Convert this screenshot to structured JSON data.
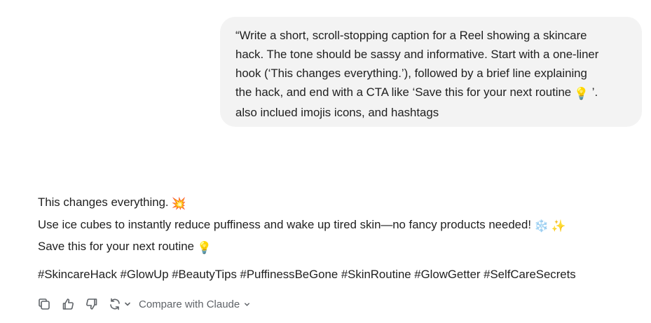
{
  "prompt": {
    "lines": [
      "“Write a short, scroll-stopping caption for a Reel showing a skincare",
      "hack. The tone should be sassy and informative. Start with a one-liner",
      "hook (‘This changes everything.’), followed by a brief line explaining",
      "the hack, and end with a CTA like ‘Save this for your next routine",
      "also inclued imojis icons, and hashtags"
    ],
    "line4_emoji": "💡",
    "line4_tail": " ’."
  },
  "response": {
    "hook": "This changes everything.",
    "hook_emoji": "💥",
    "explain": "Use ice cubes to instantly reduce puffiness and wake up tired skin—no fancy products needed!",
    "explain_emoji_1": "❄️",
    "explain_emoji_2": "✨",
    "cta": "Save this for your next routine",
    "cta_emoji": "💡",
    "hashtags": "#SkincareHack #GlowUp #BeautyTips #PuffinessBeGone #SkinRoutine #GlowGetter #SelfCareSecrets"
  },
  "toolbar": {
    "icons": [
      "copy-icon",
      "thumbs-up-icon",
      "thumbs-down-icon",
      "refresh-icon",
      "chevron-down-icon"
    ],
    "compare_label": "Compare with Claude"
  },
  "colors": {
    "bubble_bg": "#f3f3f3",
    "text": "#1f1f1f",
    "toolbar_icon": "#5f6368"
  }
}
